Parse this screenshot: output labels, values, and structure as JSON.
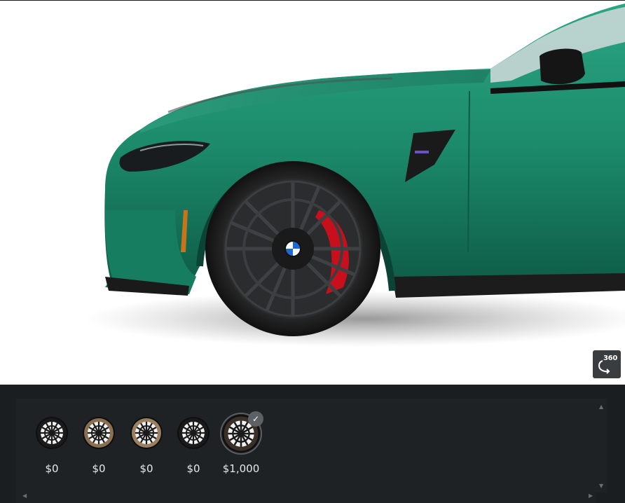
{
  "viewer": {
    "rotate_label": "360",
    "paint_color": "#1e8a6c",
    "caliper_color": "#c8101c"
  },
  "wheels": {
    "selected_index": 4,
    "options": [
      {
        "price": "$0",
        "finish": "black",
        "rim_color": "#1a1a1a"
      },
      {
        "price": "$0",
        "finish": "gold-bronze",
        "rim_color": "#8a7050"
      },
      {
        "price": "$0",
        "finish": "gold-bronze",
        "rim_color": "#9a8060"
      },
      {
        "price": "$0",
        "finish": "black",
        "rim_color": "#1a1a1a"
      },
      {
        "price": "$1,000",
        "finish": "black-bronze",
        "rim_color": "#3a3028"
      }
    ]
  },
  "icons": {
    "rotate": "rotate-360-icon",
    "check": "checkmark-icon"
  }
}
